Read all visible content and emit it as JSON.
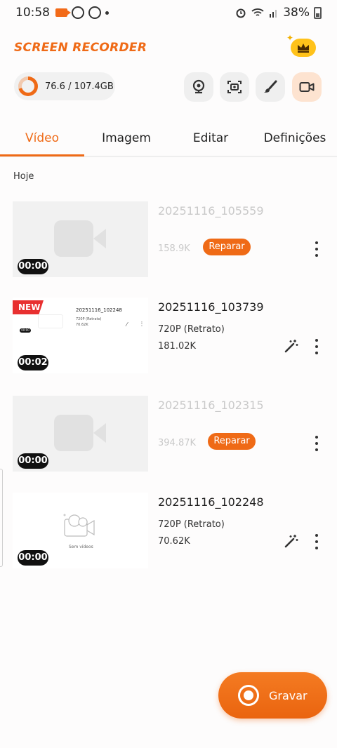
{
  "status_bar": {
    "time": "10:58",
    "battery": "38%"
  },
  "header": {
    "app_title": "SCREEN RECORDER",
    "premium_icon": "crown-icon"
  },
  "storage": {
    "text": "76.6 / 107.4GB",
    "used_fraction": 0.713
  },
  "tools": [
    {
      "name": "webcam-icon"
    },
    {
      "name": "screenshot-icon"
    },
    {
      "name": "brush-icon"
    },
    {
      "name": "video-camera-icon",
      "active": true
    }
  ],
  "tabs": [
    {
      "label": "Vídeo",
      "active": true
    },
    {
      "label": "Imagem"
    },
    {
      "label": "Editar"
    },
    {
      "label": "Definições"
    }
  ],
  "section": {
    "label": "Hoje"
  },
  "videos": [
    {
      "title": "20251116_105559",
      "size": "158.9K",
      "duration": "00:00",
      "repair_label": "Reparar",
      "broken": true
    },
    {
      "title": "20251116_103739",
      "resolution": "720P (Retrato)",
      "size": "181.02K",
      "duration": "00:02",
      "badge": "NEW",
      "preview": {
        "title": "20251116_102248",
        "resolution": "720P (Retrato)",
        "size": "70.62K",
        "duration": "00:00"
      }
    },
    {
      "title": "20251116_102315",
      "size": "394.87K",
      "duration": "00:00",
      "repair_label": "Reparar",
      "broken": true
    },
    {
      "title": "20251116_102248",
      "resolution": "720P (Retrato)",
      "size": "70.62K",
      "duration": "00:00",
      "preview": {
        "empty_text": "Sem vídeos"
      }
    }
  ],
  "fab": {
    "label": "Gravar"
  },
  "colors": {
    "accent": "#ef6a16",
    "crown": "#ffc21a",
    "new_badge": "#e83030"
  }
}
